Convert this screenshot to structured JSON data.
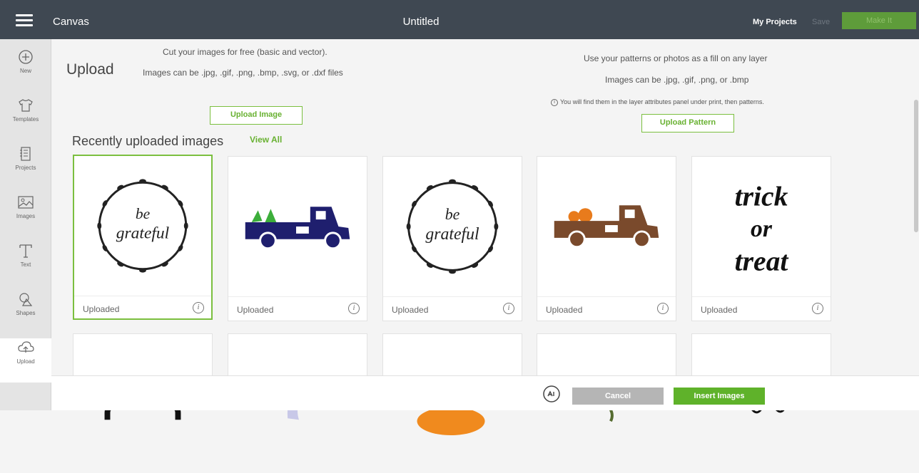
{
  "topbar": {
    "app_title": "Canvas",
    "doc_title": "Untitled",
    "my_projects": "My Projects",
    "save": "Save",
    "make_it": "Make It"
  },
  "sidenav": {
    "items": [
      {
        "label": "New",
        "icon": "plus-circle-icon"
      },
      {
        "label": "Templates",
        "icon": "tshirt-icon"
      },
      {
        "label": "Projects",
        "icon": "projects-icon"
      },
      {
        "label": "Images",
        "icon": "image-icon"
      },
      {
        "label": "Text",
        "icon": "text-icon"
      },
      {
        "label": "Shapes",
        "icon": "shapes-icon"
      },
      {
        "label": "Upload",
        "icon": "cloud-upload-icon"
      }
    ]
  },
  "upload": {
    "title": "Upload",
    "left_line1": "Cut your images for free (basic and vector).",
    "left_line2": "Images can be .jpg, .gif, .png, .bmp, .svg, or .dxf files",
    "upload_image_btn": "Upload Image",
    "right_line1": "Use your patterns or photos as a fill on any layer",
    "right_line2": "Images can be .jpg, .gif, .png, or .bmp",
    "right_line3": "You will find them in the layer attributes panel under print, then patterns.",
    "upload_pattern_btn": "Upload Pattern"
  },
  "recent": {
    "title": "Recently uploaded images",
    "view_all": "View All",
    "cards": [
      {
        "status": "Uploaded",
        "image": "be grateful wreath",
        "selected": true
      },
      {
        "status": "Uploaded",
        "image": "blue truck with trees"
      },
      {
        "status": "Uploaded",
        "image": "be grateful wreath"
      },
      {
        "status": "Uploaded",
        "image": "brown truck with pumpkins"
      },
      {
        "status": "Uploaded",
        "image": "trick or treat"
      }
    ]
  },
  "bottom": {
    "cancel": "Cancel",
    "insert": "Insert Images"
  },
  "colors": {
    "topbar": "#3f4852",
    "accent_green": "#5fb22a",
    "truck_blue": "#1f1f6e",
    "truck_brown": "#7a4a2c",
    "pumpkin": "#e87b1c"
  }
}
